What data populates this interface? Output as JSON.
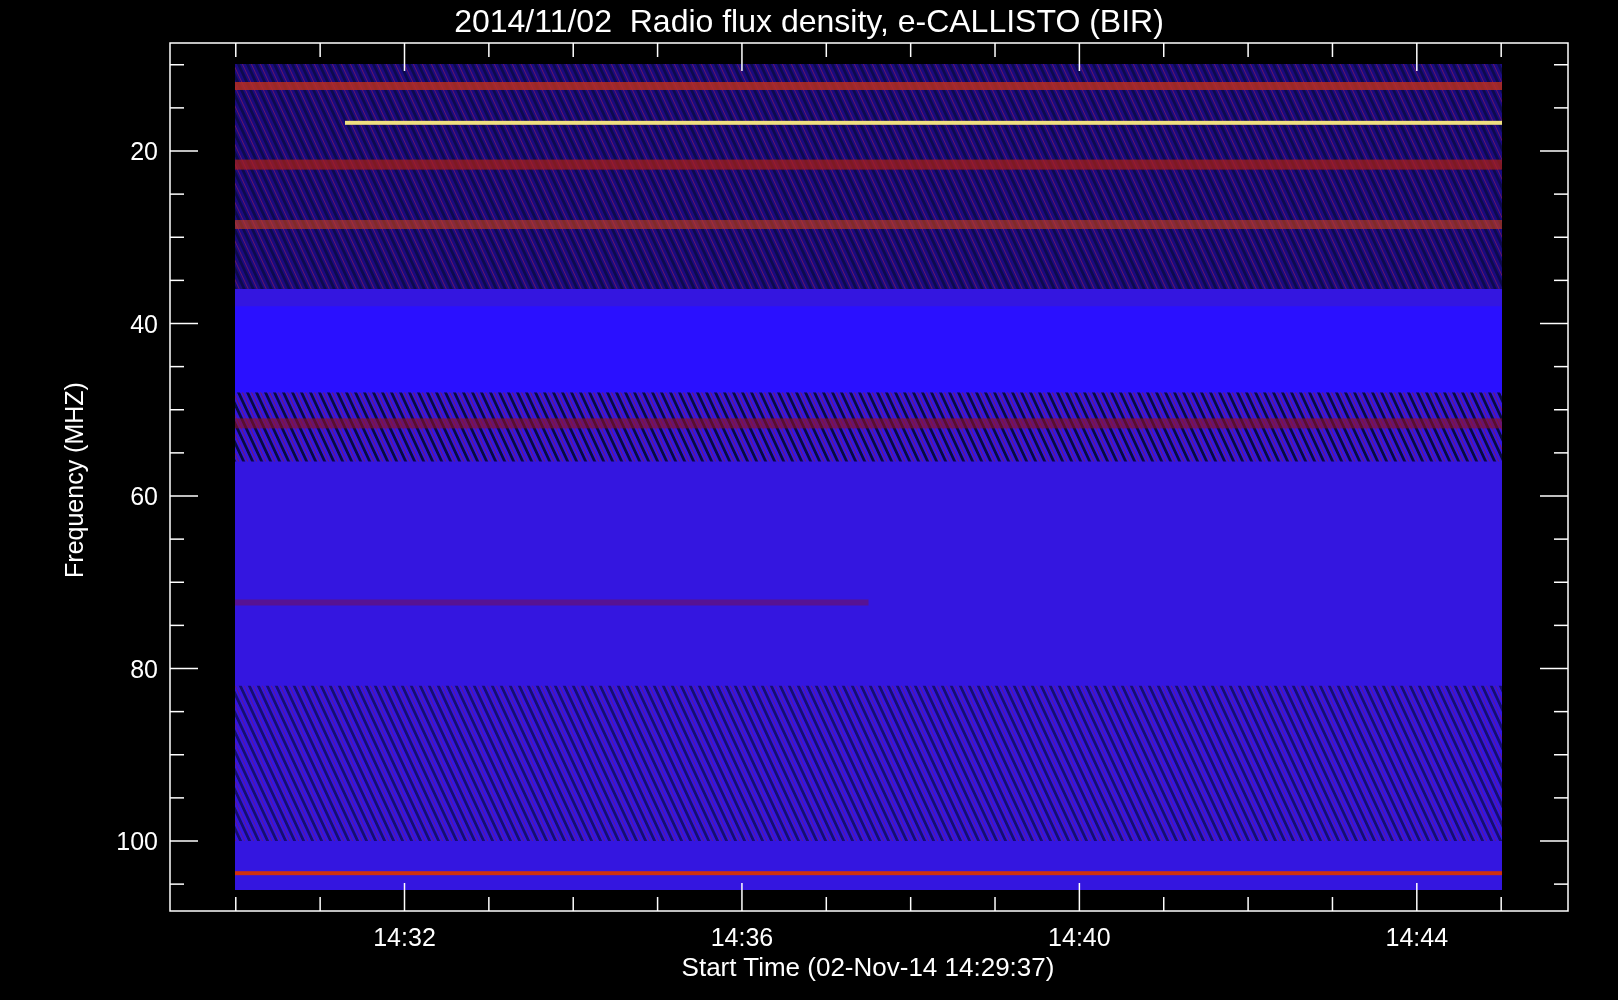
{
  "title": "2014/11/02  Radio flux density, e-CALLISTO (BIR)",
  "ylabel": "Frequency (MHZ)",
  "xlabel": "Start Time (02-Nov-14 14:29:37)",
  "yticks": [
    "20",
    "40",
    "60",
    "80",
    "100"
  ],
  "xticks": [
    "14:32",
    "14:36",
    "14:40",
    "14:44"
  ]
}
